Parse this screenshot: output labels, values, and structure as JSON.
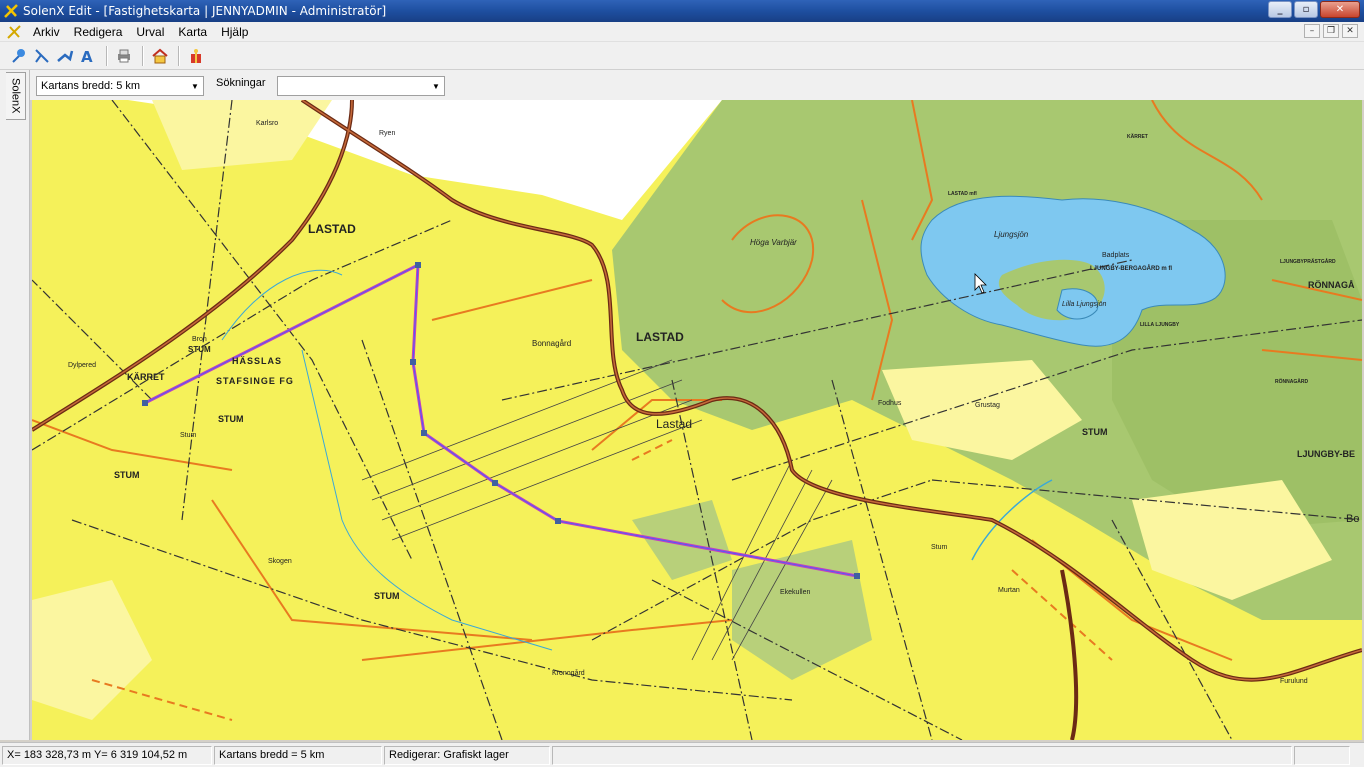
{
  "window": {
    "title": "SolenX Edit - [Fastighetskarta | JENNYADMIN - Administratör]"
  },
  "menubar": {
    "items": [
      "Arkiv",
      "Redigera",
      "Urval",
      "Karta",
      "Hjälp"
    ]
  },
  "toolbar": {
    "icons": [
      "pin-tool-icon",
      "draw-line-icon",
      "move-icon",
      "text-tool-icon",
      "print-icon",
      "home-icon",
      "gift-icon"
    ]
  },
  "sidetab": {
    "label": "SolenX"
  },
  "options": {
    "map_width": "Kartans bredd: 5 km",
    "search_label": "Sökningar",
    "search_value": ""
  },
  "map": {
    "labels": {
      "karlsro": "Karlsro",
      "ryen": "Ryen",
      "lastad_big": "LASTAD",
      "lastad_forest": "LASTAD",
      "lastad_town": "Lastad",
      "hoga_varbjar": "Höga Varbjär",
      "bonnagard": "Bonnagård",
      "dylpered": "Dylpered",
      "bron": "Bron",
      "stum1": "STUM",
      "karret": "KÄRRET",
      "hassla": "HÄSSLAS",
      "stafsinge": "STAFSINGE FG",
      "stum2": "STUM",
      "stum_small": "Stum",
      "stum3": "STUM",
      "skogen": "Skogen",
      "stum4": "STUM",
      "ekekullen": "Ekekullen",
      "kronogard": "Kronogård",
      "ljungsjon": "Ljungsjön",
      "lilla_ljungsjon": "Lilla Ljungsjön",
      "badplats": "Badplats",
      "ljungby_berga": "LJUNGBY-BERGAGÅRD m fl",
      "ronnaga": "RÖNNAGÅ",
      "ljungbyprastgard": "LJUNGBYPRÄSTGÅRD",
      "lilla_ljungby": "LILLA LJUNGBY",
      "grustag": "Grustag",
      "fodhus": "Fodhus",
      "stum5": "STUM",
      "stum6": "Stum",
      "murtan": "Murtan",
      "ljungby_be": "LJUNGBY-BE",
      "furulund": "Furulund",
      "ronnagard": "RÖNNAGÅRD",
      "karret_small": "KÄRRET",
      "lastad_small": "LASTAD mfl",
      "be": "Be"
    }
  },
  "status": {
    "coords": "X= 183 328,73 m   Y= 6 319 104,52 m",
    "map_width": "Kartans bredd = 5 km",
    "edit_layer": "Redigerar: Grafiskt lager"
  },
  "colors": {
    "field": "#f5f15a",
    "forest": "#a8c870",
    "water": "#7ec8f0",
    "road": "#6b2a14",
    "edit_line": "#c040c0",
    "path": "#e87a20"
  }
}
